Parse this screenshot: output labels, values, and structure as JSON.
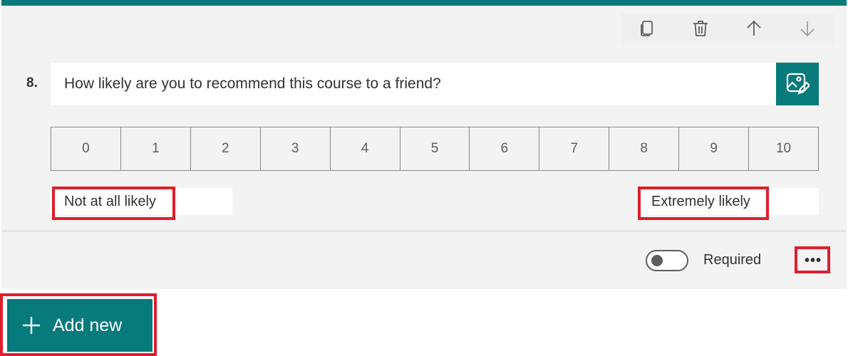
{
  "question": {
    "number": "8.",
    "text": "How likely are you to recommend this course to a friend?",
    "scale": [
      "0",
      "1",
      "2",
      "3",
      "4",
      "5",
      "6",
      "7",
      "8",
      "9",
      "10"
    ],
    "left_label": "Not at all likely",
    "right_label": "Extremely likely"
  },
  "toolbar": {
    "icons": [
      "copy-icon",
      "delete-icon",
      "move-up-icon",
      "move-down-icon"
    ]
  },
  "footer": {
    "required_label": "Required",
    "required_on": false,
    "more_label": "•••"
  },
  "add_new": {
    "label": "Add new"
  },
  "colors": {
    "accent": "#077a7c",
    "highlight": "#e01e2b",
    "card": "#f3f3f3"
  }
}
